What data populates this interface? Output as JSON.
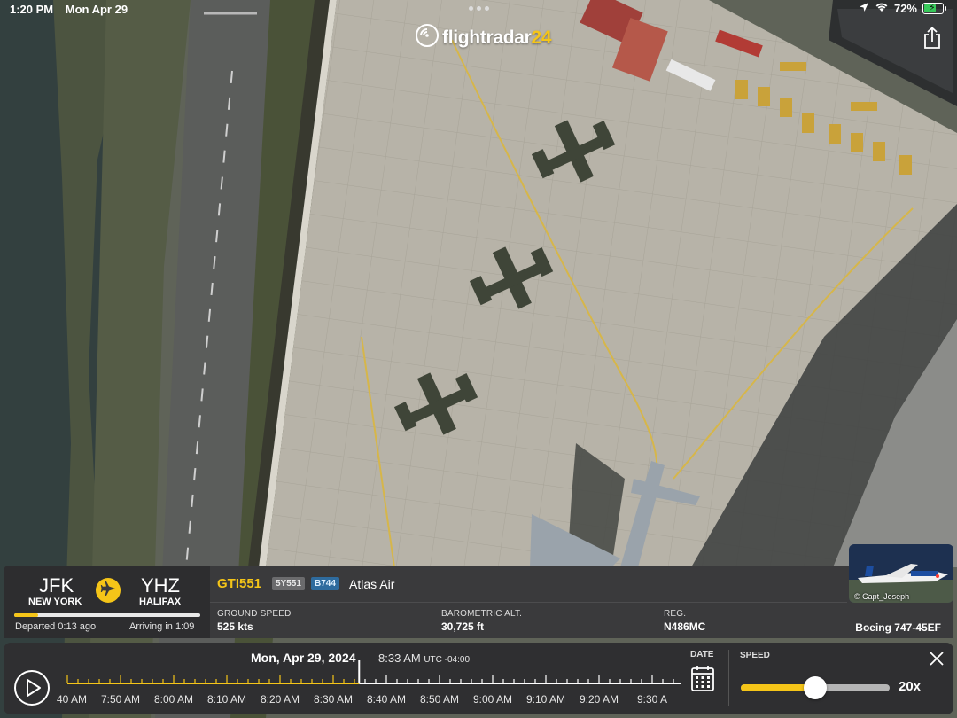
{
  "status_bar": {
    "time": "1:20 PM",
    "date": "Mon Apr 29",
    "battery": "72%",
    "battery_level": 0.72
  },
  "logo": {
    "text_main": "flightradar",
    "text_accent": "24"
  },
  "flight": {
    "origin_code": "JFK",
    "origin_city": "NEW YORK",
    "destination_code": "YHZ",
    "destination_city": "HALIFAX",
    "progress": 0.13,
    "departed": "Departed 0:13 ago",
    "arriving": "Arriving in 1:09",
    "callsign": "GTI551",
    "flight_number": "5Y551",
    "aircraft_code": "B744",
    "airline": "Atlas Air",
    "ground_speed_label": "GROUND SPEED",
    "ground_speed": "525 kts",
    "altitude_label": "BAROMETRIC ALT.",
    "altitude": "30,725 ft",
    "reg_label": "REG.",
    "registration": "N486MC",
    "aircraft_model": "Boeing 747-45EF",
    "photo_credit": "© Capt_Joseph"
  },
  "playback": {
    "date": "Mon, Apr 29, 2024",
    "time": "8:33 AM",
    "timezone": "UTC -04:00",
    "position": 0.49,
    "ticks": [
      "7:40 AM",
      "7:50 AM",
      "8:00 AM",
      "8:10 AM",
      "8:20 AM",
      "8:30 AM",
      "8:40 AM",
      "8:50 AM",
      "9:00 AM",
      "9:10 AM",
      "9:20 AM",
      "9:30 A"
    ],
    "date_label": "DATE",
    "speed_label": "SPEED",
    "speed_value": "20x",
    "speed_level": 0.5
  },
  "colors": {
    "accent": "#f5c518",
    "panel": "#3a3a3c",
    "type_badge": "#2e6b9e"
  }
}
